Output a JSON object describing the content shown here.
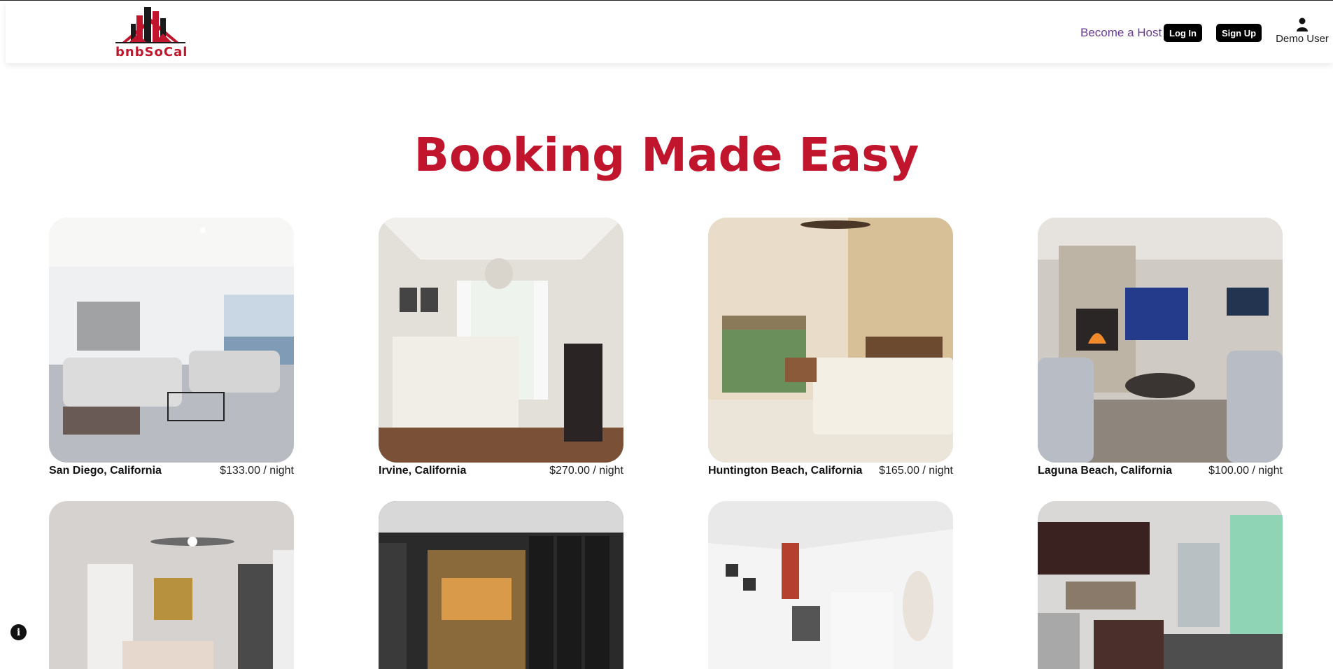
{
  "header": {
    "logo_text": "bnbSoCal",
    "become_host": "Become a Host",
    "login": "Log In",
    "signup": "Sign Up",
    "user_label": "Demo User"
  },
  "hero": {
    "title": "Booking Made Easy"
  },
  "listings": [
    {
      "location": "San Diego, California",
      "price": "$133.00 / night"
    },
    {
      "location": "Irvine, California",
      "price": "$270.00 / night"
    },
    {
      "location": "Huntington Beach, California",
      "price": "$165.00 / night"
    },
    {
      "location": "Laguna Beach, California",
      "price": "$100.00 / night"
    },
    {
      "location": "",
      "price": ""
    },
    {
      "location": "",
      "price": ""
    },
    {
      "location": "",
      "price": ""
    },
    {
      "location": "",
      "price": ""
    }
  ],
  "colors": {
    "brand": "#c0152c",
    "host_link": "#6b3d91",
    "button": "#000000"
  },
  "icons": {
    "user": "user-icon",
    "info": "info-icon"
  }
}
